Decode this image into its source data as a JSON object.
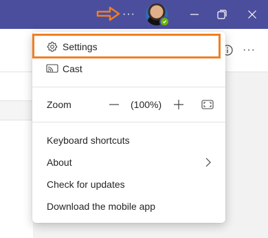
{
  "titlebar": {
    "more_glyph": "···",
    "annotation_color": "#f07f22"
  },
  "toolbar": {
    "more_glyph": "···"
  },
  "menu": {
    "settings_label": "Settings",
    "cast_label": "Cast",
    "zoom_label": "Zoom",
    "zoom_value": "(100%)",
    "keyboard_shortcuts_label": "Keyboard shortcuts",
    "about_label": "About",
    "check_updates_label": "Check for updates",
    "download_mobile_label": "Download the mobile app"
  },
  "colors": {
    "titlebar": "#4b4e9c",
    "highlight": "#f07f22",
    "status_available": "#6bb700"
  },
  "icons": {
    "settings": "gear-icon",
    "cast": "cast-icon",
    "zoom_out": "minus-icon",
    "zoom_in": "plus-icon",
    "fullscreen": "fullscreen-icon",
    "about": "chevron-right-icon"
  }
}
